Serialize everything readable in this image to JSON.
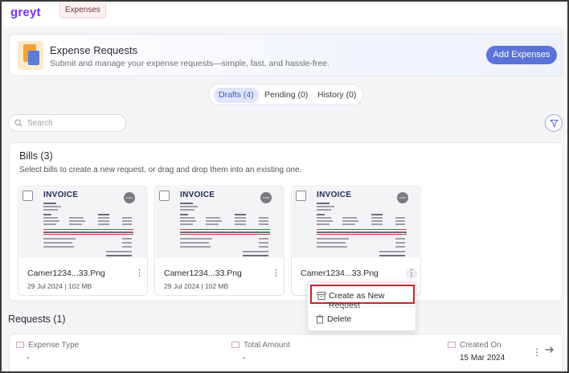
{
  "app": {
    "logo_text": "greyt",
    "logo_dot": "•",
    "breadcrumb_tab": "Expenses"
  },
  "header": {
    "title": "Expense Requests",
    "subtitle": "Submit and manage your expense requests—simple, fast, and hassle-free.",
    "add_button": "Add Expenses"
  },
  "tabs": [
    {
      "label": "Drafts (4)",
      "active": true
    },
    {
      "label": "Pending (0)",
      "active": false
    },
    {
      "label": "History (0)",
      "active": false
    }
  ],
  "search": {
    "placeholder": "Search"
  },
  "bills": {
    "title": "Bills (3)",
    "subtitle": "Select bills to create a new request, or drag and drop them into an existing one.",
    "thumbnail": {
      "heading": "INVOICE",
      "logo_text": "LOGO"
    },
    "cards": [
      {
        "filename": "Camer1234...33.Png",
        "meta": "29 Jul 2024 | 102 MB"
      },
      {
        "filename": "Camer1234...33.Png",
        "meta": "29 Jul 2024 | 102 MB"
      },
      {
        "filename": "Camer1234...33.Png",
        "meta": ""
      }
    ]
  },
  "context_menu": {
    "items": [
      {
        "label": "Create as New Request",
        "icon": "archive-icon",
        "highlighted": true
      },
      {
        "label": "Delete",
        "icon": "trash-icon",
        "highlighted": false
      }
    ]
  },
  "requests": {
    "title": "Requests (1)",
    "columns": [
      "Expense Type",
      "Total Amount",
      "Created On"
    ],
    "row": {
      "expense_type": "-",
      "total_amount": "-",
      "created_on": "15 Mar 2024"
    }
  },
  "colors": {
    "accent": "#5b72d9",
    "highlight_border": "#d0202a",
    "logo": "#7b2ff7"
  }
}
